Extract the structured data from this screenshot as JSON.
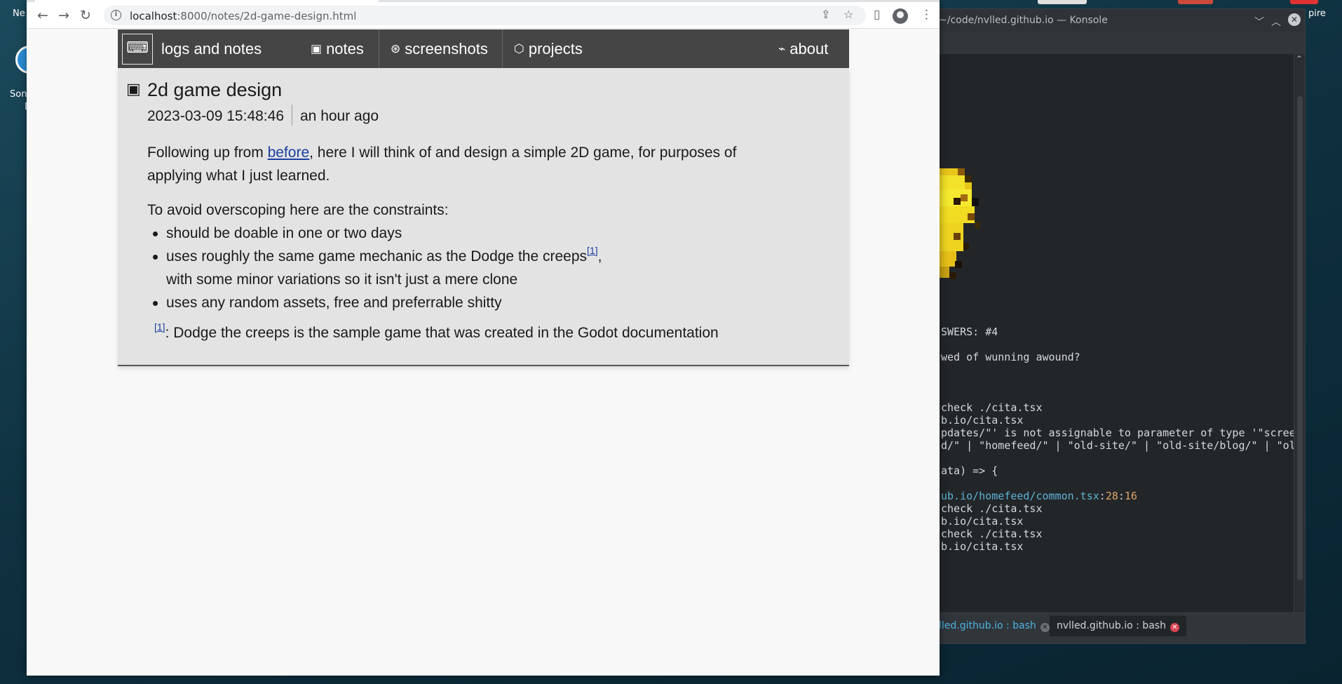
{
  "desktop": {
    "left_icon_label_line1": "Son",
    "left_icon_label_line2": "D",
    "top_label_left": "Ne",
    "top_label_right": "pire"
  },
  "konsole": {
    "title": "~/code/nvlled.github.io — Konsole",
    "lines": [
      "SWERS: #4",
      "wed of wunning awound?",
      "check ./cita.tsx",
      "b.io/cita.tsx",
      "pdates/\"' is not assignable to parameter of type '\"scree",
      "d/\" | \"homefeed/\" | \"old-site/\" | \"old-site/blog/\" | \"ol",
      "ata) => {",
      "check ./cita.tsx",
      "b.io/cita.tsx",
      "check ./cita.tsx",
      "b.io/cita.tsx"
    ],
    "error_path": "ub.io/homefeed/common.tsx",
    "error_line": "28",
    "error_col": "16",
    "tabs": [
      {
        "label": "lled.github.io : bash",
        "active": false
      },
      {
        "label": "nvlled.github.io : bash",
        "active": true
      }
    ]
  },
  "browser": {
    "url_host": "localhost",
    "url_path": ":8000/notes/2d-game-design.html",
    "icons": {
      "back": "back-arrow-icon",
      "forward": "forward-arrow-icon",
      "reload": "reload-icon",
      "info": "site-info-icon",
      "share": "share-icon",
      "bookmark": "star-icon",
      "side_panel": "side-panel-icon",
      "profile": "profile-icon",
      "menu": "kebab-menu-icon"
    }
  },
  "site": {
    "brand": "logs and notes",
    "nav": {
      "notes": "notes",
      "screenshots": "screenshots",
      "projects": "projects",
      "about": "about"
    },
    "post": {
      "title": "2d game design",
      "date": "2023-03-09 15:48:46",
      "relative": "an hour ago",
      "intro_before_link": "Following up from ",
      "intro_link": "before",
      "intro_after_link": ", here I will think of and design a simple 2D game, for purposes of applying what I just learned.",
      "constraints_intro": "To avoid overscoping here are the constraints:",
      "constraints": {
        "item1": "should be doable in one or two days",
        "item2_a": "uses roughly the same game mechanic as the Dodge the creeps",
        "item2_ref": "[1]",
        "item2_b": ",",
        "item2_c": "with some minor variations so it isn't just a mere clone",
        "item3": "uses any random assets, free and preferrable shitty"
      },
      "footnote_ref": "[1]",
      "footnote_text": ": Dodge the creeps is the sample game that was created in the Godot documentation"
    }
  }
}
